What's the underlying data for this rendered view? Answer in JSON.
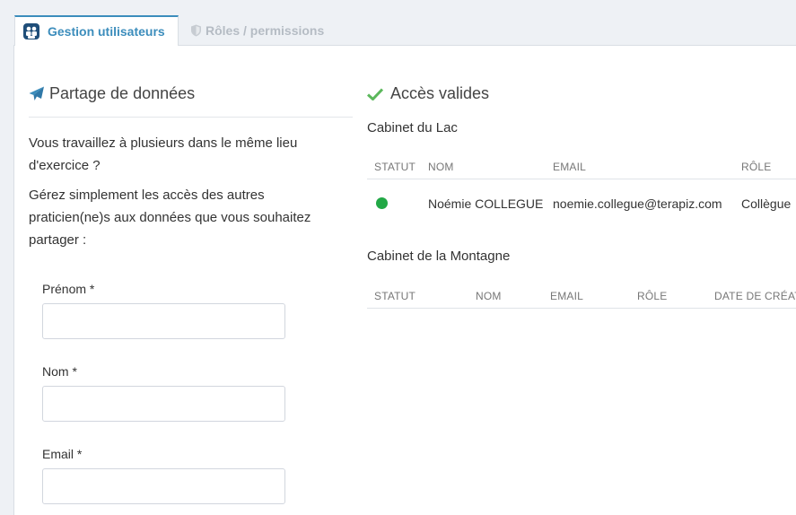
{
  "tabs": [
    {
      "label": "Gestion utilisateurs",
      "icon": "users-icon",
      "active": true
    },
    {
      "label": "Rôles / permissions",
      "icon": "shield-icon",
      "active": false
    }
  ],
  "left": {
    "title": "Partage de données",
    "title_icon": "paper-plane-icon",
    "intro1": "Vous travaillez à plusieurs dans le même lieu d'exercice ?",
    "intro2": "Gérez simplement les accès des autres praticien(ne)s aux données que vous souhaitez partager :",
    "fields": [
      {
        "label": "Prénom *",
        "value": ""
      },
      {
        "label": "Nom *",
        "value": ""
      },
      {
        "label": "Email *",
        "value": ""
      }
    ]
  },
  "right": {
    "title": "Accès valides",
    "title_icon": "check-icon",
    "cabinets": [
      {
        "name": "Cabinet du Lac",
        "headers": [
          "STATUT",
          "NOM",
          "EMAIL",
          "RÔLE"
        ],
        "rows": [
          {
            "status_color": "#22a846",
            "name": "Noémie COLLEGUE",
            "email": "noemie.collegue@terapiz.com",
            "role": "Collègue"
          }
        ]
      },
      {
        "name": "Cabinet de la Montagne",
        "headers": [
          "STATUT",
          "NOM",
          "EMAIL",
          "RÔLE",
          "DATE DE CRÉATION"
        ],
        "rows": []
      }
    ]
  },
  "colors": {
    "accent": "#3c8dbc",
    "success": "#5cb85c",
    "status_active": "#22a846"
  }
}
